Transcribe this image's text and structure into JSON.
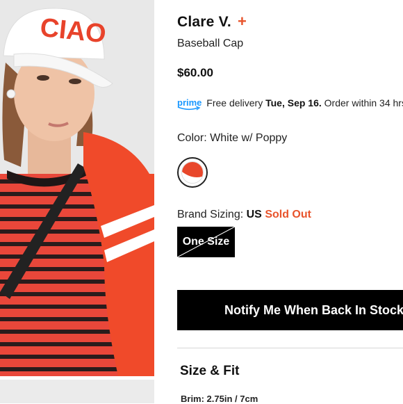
{
  "product_image": {
    "cap_text": "CIAO",
    "colors": {
      "cap": "#ffffff",
      "cap_text": "#e8432b",
      "jacket": "#f04a2a",
      "stripe_red": "#e9473a",
      "stripe_dark": "#2a1c1c"
    }
  },
  "brand": "Clare V.",
  "brand_plus": "+",
  "product_name": "Baseball Cap",
  "price": "$60.00",
  "delivery": {
    "prime_label": "prime",
    "prefix": "Free delivery",
    "date": "Tue, Sep 16.",
    "suffix": "Order within 34 hrs"
  },
  "color": {
    "label": "Color:",
    "value": "White w/ Poppy",
    "swatch_colors": [
      "#ffffff",
      "#e8472b"
    ]
  },
  "sizing": {
    "label": "Brand Sizing:",
    "system": "US",
    "status": "Sold Out",
    "options": [
      "One Size"
    ]
  },
  "notify_button": "Notify Me When Back In Stock",
  "size_fit": {
    "heading": "Size & Fit",
    "brim": "Brim: 2.75in / 7cm"
  },
  "accent_color": "#e8542c"
}
